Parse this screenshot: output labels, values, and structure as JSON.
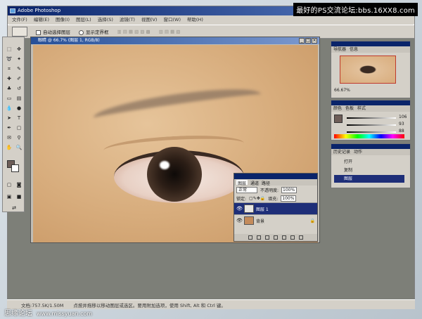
{
  "site_tag": "最好的PS交流论坛:bbs.16XX8.com",
  "watermark": {
    "brand": "思缘论坛",
    "url": "www.missyuan.com"
  },
  "titlebar": {
    "title": "Adobe Photoshop"
  },
  "menubar": [
    "文件(F)",
    "编辑(E)",
    "图像(I)",
    "图层(L)",
    "选择(S)",
    "滤镜(T)",
    "视图(V)",
    "窗口(W)",
    "帮助(H)"
  ],
  "optbar": {
    "option1": "自动选择图层",
    "option2": "显示定界框"
  },
  "document": {
    "title": "眼睛 @ 66.7% (图层 1, RGB/8)"
  },
  "layers_panel": {
    "tabs": [
      "图层",
      "通道",
      "路径"
    ],
    "blend_mode": "正常",
    "opacity_label": "不透明度:",
    "opacity_value": "100%",
    "lock_label": "锁定:",
    "fill_label": "填充:",
    "fill_value": "100%",
    "layers": [
      {
        "name": "图层 1",
        "active": true,
        "thumb_color": "#e8e6e2"
      },
      {
        "name": "背景",
        "active": false,
        "thumb_color": "#c48b5b"
      }
    ]
  },
  "navigator": {
    "tabs": [
      "导航器",
      "信息"
    ],
    "zoom": "66.67%"
  },
  "color_panel": {
    "tabs": [
      "颜色",
      "色板",
      "样式"
    ],
    "values": [
      "106",
      "93",
      "88"
    ]
  },
  "history_panel": {
    "tabs": [
      "历史记录",
      "动作"
    ],
    "items": [
      "打开",
      "复制",
      "图层"
    ]
  },
  "statusbar": {
    "doc": "文档:757.5K/1.50M",
    "hint": "点按并拖移以移动图层或选区。要用附加选项，使用 Shift, Alt 和 Ctrl 键。"
  }
}
